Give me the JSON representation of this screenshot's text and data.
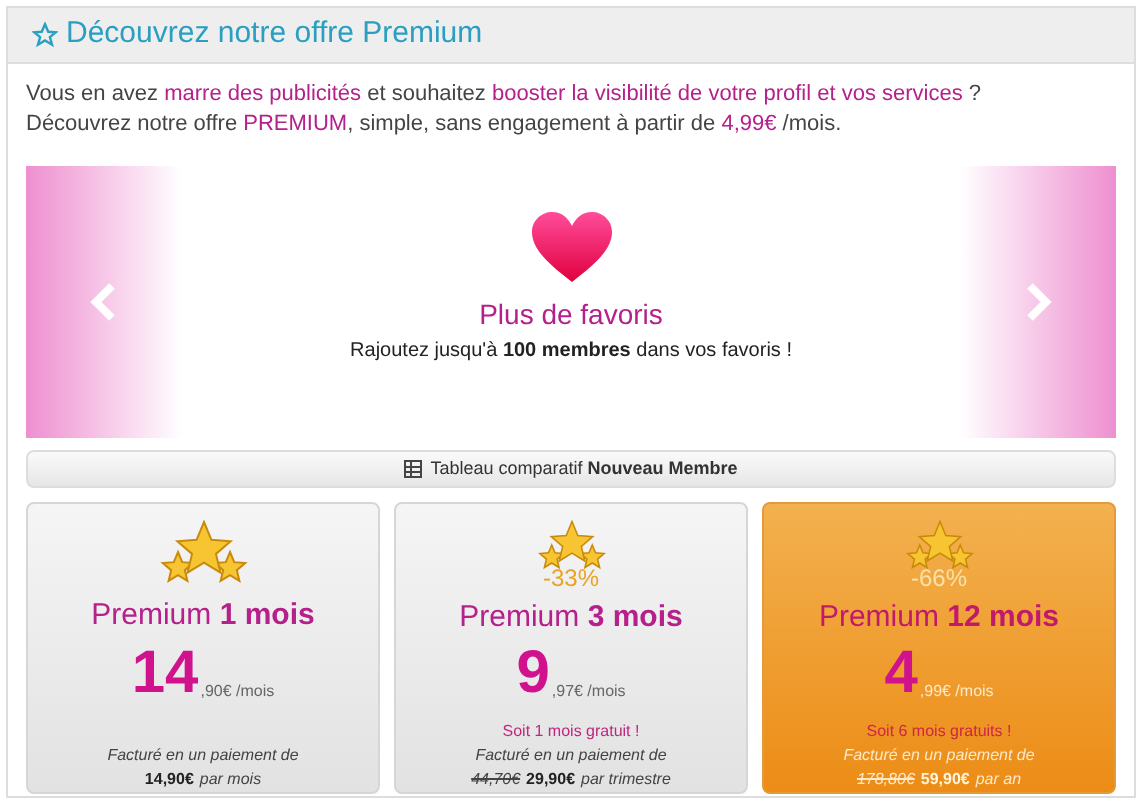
{
  "header": {
    "title": "Découvrez notre offre Premium"
  },
  "intro": [
    [
      {
        "text": "Vous en avez ",
        "kind": "plain"
      },
      {
        "text": "marre des publicités",
        "kind": "highlight"
      },
      {
        "text": " et souhaitez ",
        "kind": "plain"
      },
      {
        "text": "booster la visibilité de votre profil et vos services",
        "kind": "highlight"
      },
      {
        "text": " ?",
        "kind": "plain"
      }
    ],
    [
      {
        "text": "Découvrez notre offre ",
        "kind": "plain"
      },
      {
        "text": "PREMIUM",
        "kind": "highlight"
      },
      {
        "text": ", simple, sans engagement à partir de ",
        "kind": "plain"
      },
      {
        "text": "4,99€",
        "kind": "highlight"
      },
      {
        "text": " /mois.",
        "kind": "plain"
      }
    ]
  ],
  "carousel": {
    "title": "Plus de favoris",
    "text": "Rajoutez jusqu'à **100 membres** dans vos favoris !"
  },
  "compare_button": "Tableau comparatif **Nouveau Membre**",
  "plans": [
    {
      "name": "Premium **1 mois**",
      "selected": false,
      "price": "14",
      "cents": ",90€ /mois",
      "billing": "Facturé en un paiement de",
      "new_price": "14,90€",
      "period": "par mois"
    },
    {
      "name": "Premium **3 mois**",
      "selected": false,
      "discount": "-33%",
      "price": "9",
      "cents": ",97€ /mois",
      "free": "Soit 1 mois gratuit !",
      "billing": "Facturé en un paiement de",
      "old_price": "44,70€",
      "new_price": "29,90€",
      "period": "par trimestre"
    },
    {
      "name": "Premium **12 mois**",
      "selected": true,
      "discount": "-66%",
      "price": "4",
      "cents": ",99€ /mois",
      "free": "Soit 6 mois gratuits !",
      "billing": "Facturé en un paiement de",
      "old_price": "178,80€",
      "new_price": "59,90€",
      "period": "par an"
    }
  ]
}
